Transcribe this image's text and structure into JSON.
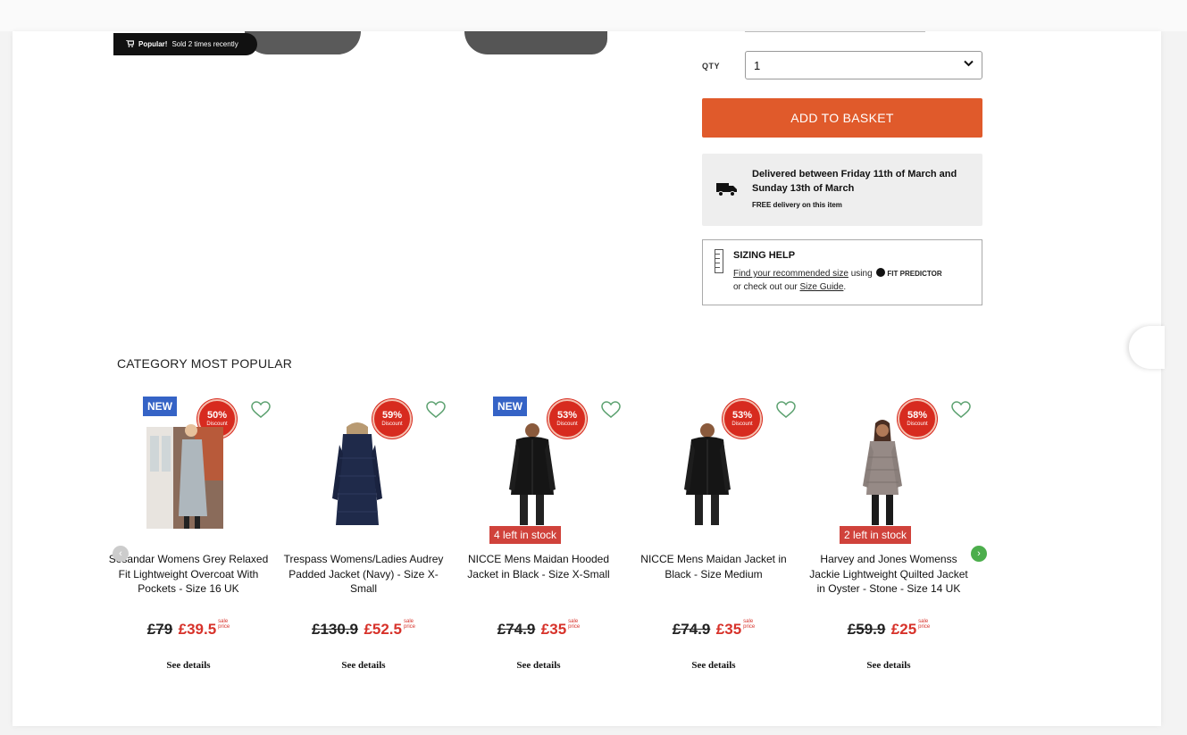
{
  "product": {
    "popular_badge_bold": "Popular!",
    "popular_badge_text": "Sold 2 times recently",
    "qty_label": "QTY",
    "qty_value": "1",
    "add_to_basket": "ADD TO BASKET",
    "delivery_line1": "Delivered between Friday 11th of March and Sunday 13th of March",
    "delivery_line2": "FREE delivery on this item",
    "sizing_title": "SIZING HELP",
    "sizing_link1": "Find your recommended size",
    "sizing_using": "using",
    "sizing_fit_predictor": "FIT PREDICTOR",
    "sizing_or": "or check out our",
    "sizing_link2": "Size Guide",
    "sizing_period": "."
  },
  "category": {
    "title": "CATEGORY MOST POPULAR",
    "prev_arrow": "‹",
    "next_arrow": "›",
    "items": [
      {
        "new_badge": "NEW",
        "discount": "50%",
        "discount_label": "Discount",
        "stock": "",
        "name": "Sosandar Womens Grey Relaxed Fit Lightweight Overcoat With Pockets - Size 16 UK",
        "old_price": "£79",
        "new_price": "£39.5",
        "sale_label_1": "sale",
        "sale_label_2": "price",
        "details": "See details",
        "photo": "woman-grey-coat"
      },
      {
        "new_badge": "",
        "discount": "59%",
        "discount_label": "Discount",
        "stock": "",
        "name": "Trespass Womens/Ladies Audrey Padded Jacket (Navy) - Size X-Small",
        "old_price": "£130.9",
        "new_price": "£52.5",
        "sale_label_1": "sale",
        "sale_label_2": "price",
        "details": "See details",
        "photo": "navy-long-padded-jacket"
      },
      {
        "new_badge": "NEW",
        "discount": "53%",
        "discount_label": "Discount",
        "stock": "4 left in stock",
        "name": "NICCE Mens Maidan Hooded Jacket in Black - Size X-Small",
        "old_price": "£74.9",
        "new_price": "£35",
        "sale_label_1": "sale",
        "sale_label_2": "price",
        "details": "See details",
        "photo": "man-black-hooded-jacket"
      },
      {
        "new_badge": "",
        "discount": "53%",
        "discount_label": "Discount",
        "stock": "",
        "name": "NICCE Mens Maidan Jacket in Black - Size Medium",
        "old_price": "£74.9",
        "new_price": "£35",
        "sale_label_1": "sale",
        "sale_label_2": "price",
        "details": "See details",
        "photo": "man-black-jacket"
      },
      {
        "new_badge": "",
        "discount": "58%",
        "discount_label": "Discount",
        "stock": "2 left in stock",
        "name": "Harvey and Jones Womenss Jackie Lightweight Quilted Jacket in Oyster - Stone - Size 14 UK",
        "old_price": "£59.9",
        "new_price": "£25",
        "sale_label_1": "sale",
        "sale_label_2": "price",
        "details": "See details",
        "photo": "woman-oyster-quilted-jacket"
      }
    ]
  },
  "colors": {
    "accent_orange": "#e05a2b",
    "sale_red": "#d7322a",
    "new_blue": "#3563c6",
    "next_green": "#4cae4c"
  }
}
